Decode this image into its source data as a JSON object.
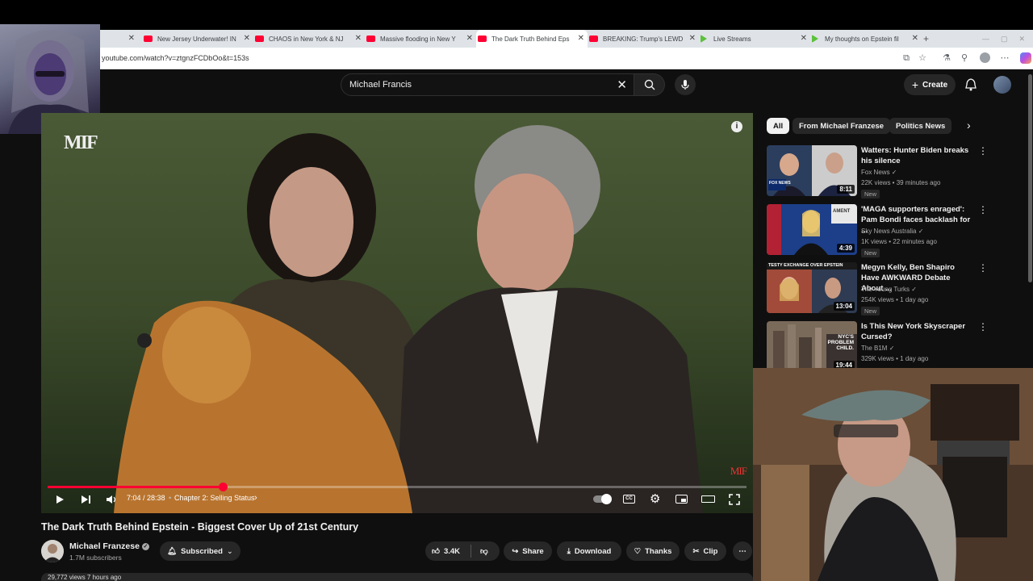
{
  "browser": {
    "tabs": [
      {
        "title": "New Jersey Underwater! IN",
        "icon": "youtube-icon"
      },
      {
        "title": "CHAOS in New York & NJ",
        "icon": "youtube-icon"
      },
      {
        "title": "Massive flooding in New Y",
        "icon": "youtube-icon"
      },
      {
        "title": "The Dark Truth Behind Eps",
        "icon": "youtube-icon",
        "active": true
      },
      {
        "title": "BREAKING: Trump's LEWD",
        "icon": "youtube-icon"
      },
      {
        "title": "Live Streams",
        "icon": "rumble-icon"
      },
      {
        "title": "My thoughts on Epstein fil",
        "icon": "rumble-icon"
      }
    ],
    "url": "youtube.com/watch?v=ztgnzFCDbOo&t=153s"
  },
  "header": {
    "search_value": "Michael Francis",
    "create_label": "Create"
  },
  "video": {
    "watermark": "MIF",
    "progress_fraction": 0.25,
    "time": "7:04 / 28:38",
    "chapter": "Chapter 2: Selling Status",
    "title": "The Dark Truth Behind Epstein - Biggest Cover Up of 21st Century",
    "views_line": "29,772 views  7 hours ago"
  },
  "channel": {
    "name": "Michael Franzese",
    "subscribers": "1.7M subscribers",
    "subscribed_label": "Subscribed"
  },
  "actions": {
    "likes": "3.4K",
    "share": "Share",
    "download": "Download",
    "thanks": "Thanks",
    "clip": "Clip"
  },
  "chips": [
    "All",
    "From Michael Franzese",
    "Politics News"
  ],
  "recommendations": [
    {
      "title": "Watters: Hunter Biden breaks his silence",
      "channel": "Fox News",
      "meta": "22K views • 39 minutes ago",
      "badge": "New",
      "duration": "8:11",
      "thumb_text": "FOX NEWS"
    },
    {
      "title": "'MAGA supporters enraged': Pam Bondi faces backlash for ...",
      "channel": "Sky News Australia",
      "meta": "1K views • 22 minutes ago",
      "badge": "New",
      "duration": "4:39",
      "thumb_text": "AMENT"
    },
    {
      "title": "Megyn Kelly, Ben Shapiro Have AWKWARD Debate About ...",
      "channel": "The Young Turks",
      "meta": "254K views • 1 day ago",
      "badge": "New",
      "duration": "13:04",
      "thumb_text": "TESTY EXCHANGE OVER EPSTEIN"
    },
    {
      "title": "Is This New York Skyscraper Cursed?",
      "channel": "The B1M",
      "meta": "329K views • 1 day ago",
      "badge": "",
      "duration": "19:44",
      "thumb_text": "NYC'S PROBLEM CHILD."
    }
  ]
}
